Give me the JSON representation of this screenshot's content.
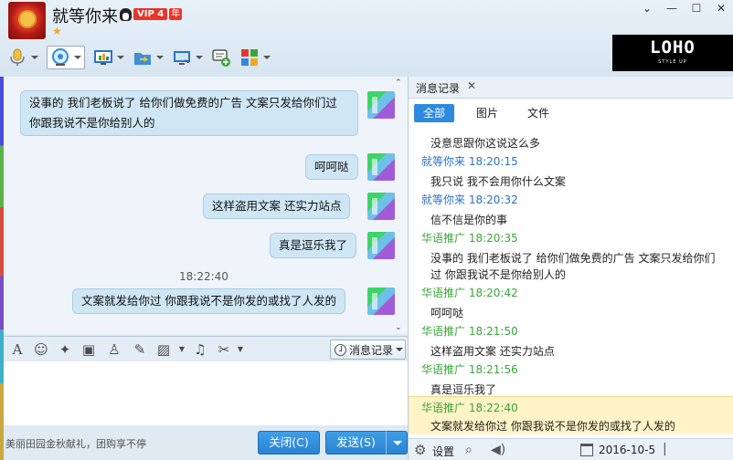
{
  "header": {
    "contact_name": "就等你来",
    "vip_label": "VIP 4",
    "vip_year": "年"
  },
  "icons": {
    "mic": "microphone-icon",
    "video": "webcam-icon",
    "screen": "screen-share-icon",
    "file": "folder-transfer-icon",
    "remote": "remote-assist-icon",
    "message": "message-add-icon",
    "apps": "apps-grid-icon"
  },
  "ad": {
    "title": "LOHO",
    "subtitle": "STYLE UP"
  },
  "chat": {
    "messages": [
      {
        "text": "没事的  我们老板说了  给你们做免费的广告  文案只发给你们过  你跟我说不是你给别人的"
      },
      {
        "text": "呵呵哒"
      },
      {
        "text": "这样盗用文案  还实力站点"
      },
      {
        "text": "真是逗乐我了"
      },
      {
        "text": "文案就发给你过  你跟我说不是你发的或找了人发的"
      }
    ],
    "timestamp": "18:22:40"
  },
  "input_toolbar": {
    "history_label": "消息记录"
  },
  "bottom": {
    "promo": "美丽田园金秋献礼，团购享不停",
    "close_label": "关闭(C)",
    "send_label": "发送(S)"
  },
  "history_pane": {
    "tab_title": "消息记录",
    "filters": [
      "全部",
      "图片",
      "文件"
    ],
    "log": [
      {
        "type": "text",
        "text": "没意思跟你这说这么多"
      },
      {
        "type": "header",
        "color": "blue",
        "text": "就等你来  18:20:15"
      },
      {
        "type": "text",
        "text": "我只说 我不会用你什么文案"
      },
      {
        "type": "header",
        "color": "blue",
        "text": "就等你来  18:20:32"
      },
      {
        "type": "text",
        "text": "信不信是你的事"
      },
      {
        "type": "header",
        "color": "green",
        "text": "华语推广  18:20:35"
      },
      {
        "type": "text",
        "text": "没事的  我们老板说了  给你们做免费的广告  文案只发给你们过  你跟我说不是你给别人的"
      },
      {
        "type": "header",
        "color": "green",
        "text": "华语推广  18:20:42"
      },
      {
        "type": "text",
        "text": "呵呵哒"
      },
      {
        "type": "header",
        "color": "green",
        "text": "华语推广  18:21:50"
      },
      {
        "type": "text",
        "text": "这样盗用文案  还实力站点"
      },
      {
        "type": "header",
        "color": "green",
        "text": "华语推广  18:21:56"
      },
      {
        "type": "text",
        "text": "真是逗乐我了"
      },
      {
        "type": "header",
        "color": "green",
        "text": "华语推广  18:22:40"
      },
      {
        "type": "text",
        "text": "文案就发给你过  你跟我说不是你发的或找了人发的"
      }
    ],
    "settings_label": "设置",
    "date": "2016-10-5"
  },
  "colors": {
    "accent": "#2d8ae0",
    "blue_name": "#2a73c8",
    "green_name": "#3aa63a",
    "bubble": "#cfe6f5"
  }
}
